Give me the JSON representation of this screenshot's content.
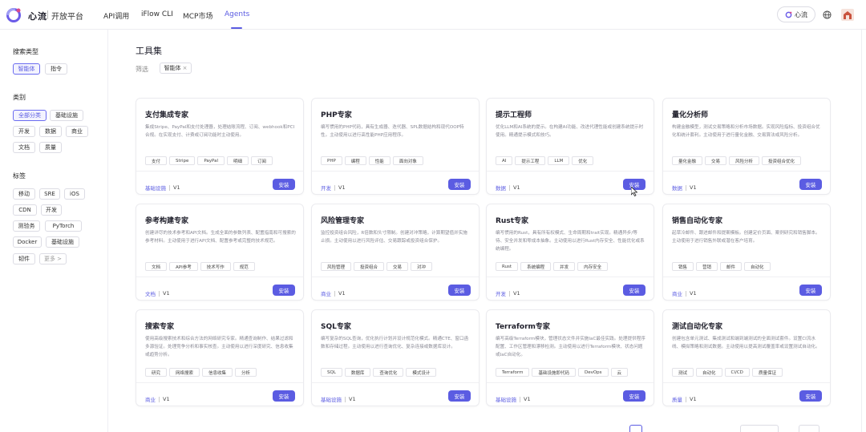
{
  "brand": {
    "name": "心流",
    "platform": "开放平台"
  },
  "nav": [
    {
      "label": "API调用",
      "active": false
    },
    {
      "label": "iFlow CLI",
      "active": false
    },
    {
      "label": "MCP市场",
      "active": false
    },
    {
      "label": "Agents",
      "active": true
    }
  ],
  "header": {
    "login_label": "心流",
    "globe_icon": "globe-icon",
    "avatar_icon": "avatar-icon"
  },
  "sidebar": {
    "search_type_title": "搜索类型",
    "search_types": [
      {
        "label": "智能体",
        "active": true
      },
      {
        "label": "指令",
        "active": false
      }
    ],
    "category_title": "类别",
    "categories": [
      {
        "label": "全部分类",
        "active": true
      },
      {
        "label": "基础设施",
        "active": false
      },
      {
        "label": "开发",
        "active": false
      },
      {
        "label": "数据",
        "active": false
      },
      {
        "label": "商业",
        "active": false
      },
      {
        "label": "文档",
        "active": false
      },
      {
        "label": "质量",
        "active": false
      }
    ],
    "tag_title": "标签",
    "tags": [
      "移动",
      "SRE",
      "iOS",
      "CDN",
      "开发",
      "测验务",
      "PyTorch",
      "Docker",
      "基础设施",
      "韧件",
      "更多 >"
    ]
  },
  "main": {
    "title": "工具集",
    "filter_label": "筛选",
    "filter_chip": "智能体",
    "install_label": "安装",
    "cards": [
      {
        "title": "支付集成专家",
        "desc": "集成Stripe、PayPal和支付处理器，处理结账流程、订阅、webhook和PCI合规。在实现支付、计费或订阅功能时主动使用。",
        "tags": [
          "支付",
          "Stripe",
          "PayPal",
          "明细",
          "订阅"
        ],
        "category": "基础设施",
        "version": "V1"
      },
      {
        "title": "PHP专家",
        "desc": "编写惯用的PHP代码，具有生成器、迭代器、SPL数据结构和现代OOP特性。主动使用以进行高性能PHP应用程序。",
        "tags": [
          "PHP",
          "编程",
          "性能",
          "面向对象"
        ],
        "category": "开发",
        "version": "V1"
      },
      {
        "title": "提示工程师",
        "desc": "优化LLM和AI系统的提示。在构建AI功能、改进代理性能或创建系统提示时使用。精通提示模式和技巧。",
        "tags": [
          "AI",
          "提示工程",
          "LLM",
          "优化"
        ],
        "category": "数据",
        "version": "V1"
      },
      {
        "title": "量化分析师",
        "desc": "构建金融模型，测试交易策略和分析市场数据。实现风险指标、投资组合优化和统计套利。主动使用于进行量化金融、交易算法或风险分析。",
        "tags": [
          "量化金融",
          "交易",
          "风险分析",
          "投资组合优化"
        ],
        "category": "数据",
        "version": "V1"
      },
      {
        "title": "参考构建专家",
        "desc": "创建详尽的技术参考和API文档。生成全面的参数列表、配置指南和可搜索的参考材料。主动使用于进行API文档、配置参考或完整的技术规范。",
        "tags": [
          "文档",
          "API参考",
          "技术写作",
          "规范"
        ],
        "category": "文档",
        "version": "V1"
      },
      {
        "title": "风险管理专家",
        "desc": "监控投资组合风险，R倍数和头寸限制。创建对冲策略，计算期望值并实施止损。主动使用以进行风险评估、交易跟踪或投资组合保护。",
        "tags": [
          "风险管理",
          "投资组合",
          "交易",
          "对冲"
        ],
        "category": "商业",
        "version": "V1"
      },
      {
        "title": "Rust专家",
        "desc": "编写惯用的Rust，具有所有权模式、生命周期和trait实现。精通异步/等待、安全并发和零成本抽象。主动使用以进行Rust内存安全、性能优化或系统编程。",
        "tags": [
          "Rust",
          "系统编程",
          "并发",
          "内存安全"
        ],
        "category": "开发",
        "version": "V1"
      },
      {
        "title": "销售自动化专家",
        "desc": "起草冷邮件、跟进邮件和提案模板。创建定价页面、案例研究和销售脚本。主动使用于进行销售外联或潜在客户培育。",
        "tags": [
          "销售",
          "营销",
          "邮件",
          "自动化"
        ],
        "category": "商业",
        "version": "V1"
      },
      {
        "title": "搜索专家",
        "desc": "使用高级搜索技术和综合方法的网络研究专家。精通查询制作、结果过滤和多源验证。处理竞争分析和事实核查。主动使用以进行深度研究、信息收集或趋势分析。",
        "tags": [
          "研究",
          "网络搜索",
          "信息收集",
          "分析"
        ],
        "category": "商业",
        "version": "V1"
      },
      {
        "title": "SQL专家",
        "desc": "编写复杂的SQL查询，优化执行计划并设计规范化模式。精通CTE、窗口函数和存储过程。主动使用以进行查询优化、复杂连接或数据库设计。",
        "tags": [
          "SQL",
          "数据库",
          "查询优化",
          "模式设计"
        ],
        "category": "基础设施",
        "version": "V1"
      },
      {
        "title": "Terraform专家",
        "desc": "编写高级Terraform模块，管理状态文件并实施IaC最佳实践。处理提供程序配置、工作区管理和漂移检测。主动使用以进行Terraform模块、状态问题或IaC自动化。",
        "tags": [
          "Terraform",
          "基础设施即代码",
          "DevOps",
          "云"
        ],
        "category": "基础设施",
        "version": "V1"
      },
      {
        "title": "测试自动化专家",
        "desc": "创建包含单元测试、集成测试和端到端测试的全面测试套件。设置CI流水线、模拟策略和测试数据。主动使用以提高测试覆盖率或设置测试自动化。",
        "tags": [
          "测试",
          "自动化",
          "CI/CD",
          "质量保证"
        ],
        "category": "质量",
        "version": "V1"
      }
    ]
  }
}
